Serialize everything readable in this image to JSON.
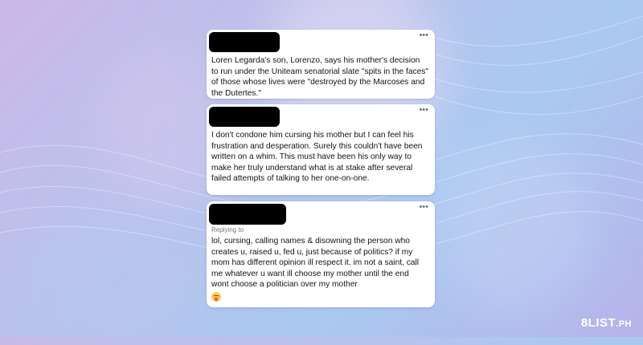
{
  "tweets": [
    {
      "author": "",
      "more_icon": "•••",
      "text": "Loren Legarda's son, Lorenzo, says his mother's decision to run under the Uniteam senatorial slate \"spits in the faces\" of those whose lives were \"destroyed by the Marcoses and the Dutertes.\""
    },
    {
      "author": "",
      "more_icon": "•••",
      "text": "I don't condone him cursing his mother but I can feel his frustration and desperation. Surely this couldn't have been written on a whim. This must have been his only way to make her truly understand what is at stake after several failed attempts of talking to her one-on-one."
    },
    {
      "author": "",
      "more_icon": "•••",
      "reply_label": "Replying to",
      "text": "lol, cursing, calling names & disowning the person who creates u, raised u, fed u, just because of politics? if my mom has different opinion ill respect it. im not a saint, call me whatever u want ill choose my mother until the end wont choose a politician over my mother",
      "emoji": "face-savoring-food-emoji"
    }
  ],
  "brand": {
    "logo_main": "8LIST",
    "logo_suffix": ".PH"
  },
  "colors": {
    "card_bg": "#ffffff",
    "text": "#0f1419",
    "muted": "#657786",
    "redaction": "#000000"
  }
}
